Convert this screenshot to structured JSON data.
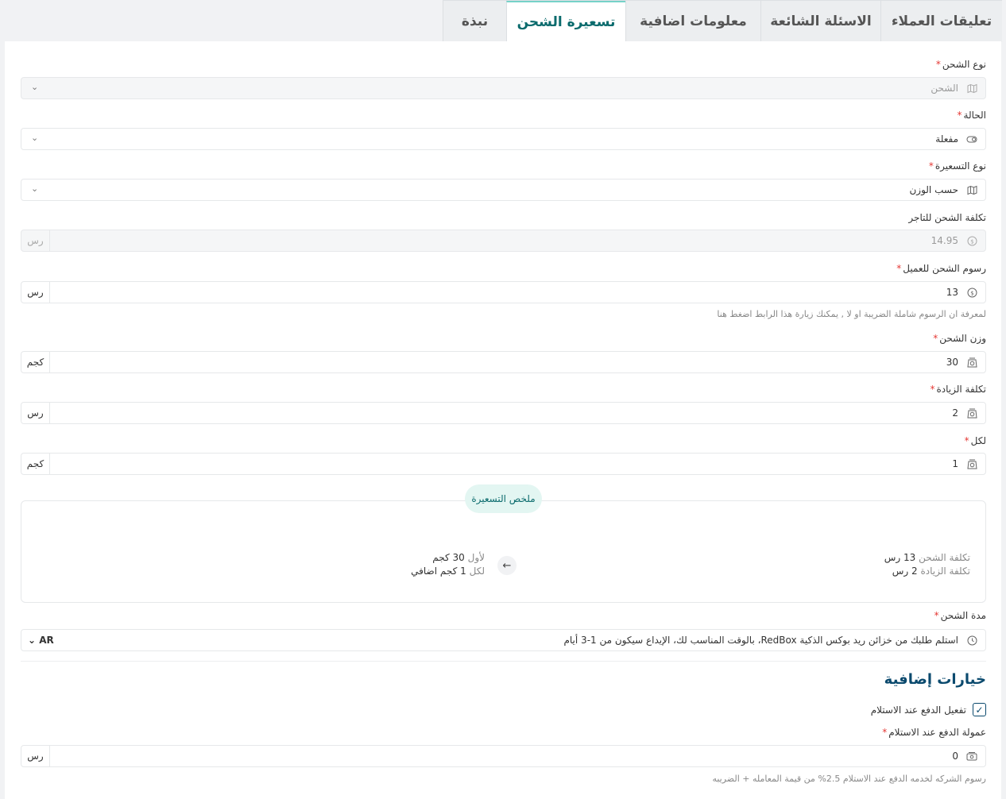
{
  "tabs": [
    "تعليقات العملاء",
    "الاسئلة الشائعة",
    "معلومات اضافية",
    "تسعيرة الشحن",
    "نبذة"
  ],
  "active_tab": "تسعيرة الشحن",
  "form": {
    "shipping_type": {
      "label": "نوع الشحن",
      "value": "الشحن"
    },
    "status": {
      "label": "الحالة",
      "value": "مفعلة"
    },
    "pricing_type": {
      "label": "نوع التسعيرة",
      "value": "حسب الوزن"
    },
    "merchant_cost": {
      "label": "تكلفة الشحن للتاجر",
      "value": "14.95",
      "unit": "رس"
    },
    "customer_fee": {
      "label": "رسوم الشحن للعميل",
      "value": "13",
      "unit": "رس",
      "hint": "لمعرفة ان الرسوم شاملة الضريبة او لا , يمكنك زيارة هذا الرابط اضغط هنا"
    },
    "weight": {
      "label": "وزن الشحن",
      "value": "30",
      "unit": "كجم"
    },
    "extra_cost": {
      "label": "تكلفة الزيادة",
      "value": "2",
      "unit": "رس"
    },
    "per": {
      "label": "لكل",
      "value": "1",
      "unit": "كجم"
    },
    "duration": {
      "label": "مدة الشحن",
      "value": "استلم طلبك من خزائن ريد بوكس الذكية RedBox، بالوقت المناسب لك، الإيداع سيكون من 1-3 أيام",
      "lang": "AR"
    }
  },
  "summary": {
    "pill": "ملخص التسعيرة",
    "cost_label": "تكلفة الشحن",
    "cost_value": "13 رس",
    "extra_label": "تكلفة الزيادة",
    "extra_value": "2 رس",
    "first_label": "لأول",
    "first_value": "30 كجم",
    "per_label": "لكل",
    "per_value": "1 كجم اضافي"
  },
  "extra_options": {
    "title": "خيارات إضافية",
    "cod_label": "تفعيل الدفع عند الاستلام",
    "cod_checked": true,
    "commission": {
      "label": "عمولة الدفع عند الاستلام",
      "value": "0",
      "unit": "رس",
      "hint": "رسوم الشركه لخدمه الدفع عند الاستلام 2.5% من قيمة المعامله + الضريبه"
    }
  },
  "icons": {
    "shipping": "map-icon",
    "status": "toggle-icon",
    "currency": "coin-icon",
    "weight": "scale-icon",
    "clock": "clock-icon",
    "cash": "cash-icon",
    "chevron": "chevron-down-icon",
    "arrow": "arrow-left-icon"
  },
  "colors": {
    "accent": "#0b6b6d",
    "heading": "#0b4a6e",
    "required": "#e53935"
  }
}
